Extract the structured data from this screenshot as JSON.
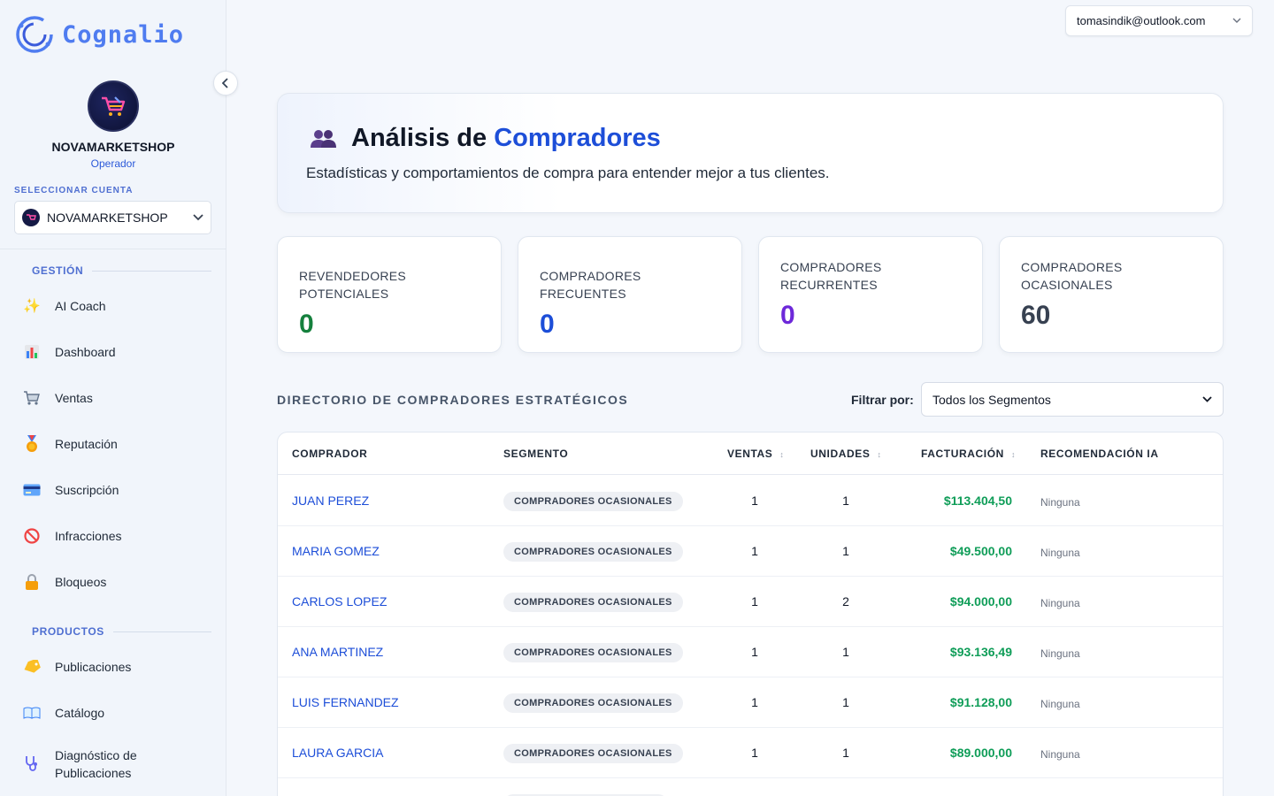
{
  "brand": {
    "name": "Cognalio"
  },
  "account": {
    "name": "NOVAMARKETSHOP",
    "role": "Operador",
    "select_label": "SELECCIONAR CUENTA",
    "selected": "NOVAMARKETSHOP"
  },
  "user": {
    "email": "tomasindik@outlook.com"
  },
  "sidebar": {
    "sections": [
      {
        "label": "GESTIÓN"
      },
      {
        "label": "PRODUCTOS"
      }
    ],
    "items": [
      {
        "label": "AI Coach",
        "icon": "sparkles-icon"
      },
      {
        "label": "Dashboard",
        "icon": "bar-chart-icon"
      },
      {
        "label": "Ventas",
        "icon": "shopping-cart-icon"
      },
      {
        "label": "Reputación",
        "icon": "medal-icon"
      },
      {
        "label": "Suscripción",
        "icon": "credit-card-icon"
      },
      {
        "label": "Infracciones",
        "icon": "prohibited-icon"
      },
      {
        "label": "Bloqueos",
        "icon": "lock-icon"
      },
      {
        "label": "Publicaciones",
        "icon": "tag-icon"
      },
      {
        "label": "Catálogo",
        "icon": "book-icon"
      },
      {
        "label": "Diagnóstico de Publicaciones",
        "label_line1": "Diagnóstico de",
        "label_line2": "Publicaciones",
        "icon": "stethoscope-icon"
      }
    ]
  },
  "header": {
    "title_part1": "Análisis de",
    "title_part2": "Compradores",
    "subtitle": "Estadísticas y comportamientos de compra para entender mejor a tus clientes."
  },
  "stats": [
    {
      "label": "REVENDEDORES POTENCIALES",
      "value": "0",
      "color": "#15803d"
    },
    {
      "label": "COMPRADORES FRECUENTES",
      "value": "0",
      "color": "#1d4ed8"
    },
    {
      "label_line1": "COMPRADORES",
      "label_line2": "RECURRENTES",
      "value": "0",
      "color": "#6d28d9"
    },
    {
      "label_line1": "COMPRADORES",
      "label_line2": "OCASIONALES",
      "value": "60",
      "color": "#374151"
    }
  ],
  "directory": {
    "title": "DIRECTORIO DE COMPRADORES ESTRATÉGICOS",
    "filter_label": "Filtrar por:",
    "filter_value": "Todos los Segmentos",
    "columns": [
      "COMPRADOR",
      "SEGMENTO",
      "VENTAS",
      "UNIDADES",
      "FACTURACIÓN",
      "RECOMENDACIÓN IA"
    ],
    "rows": [
      {
        "buyer": "JUAN PEREZ",
        "segment": "COMPRADORES OCASIONALES",
        "ventas": "1",
        "unidades": "1",
        "facturacion": "$113.404,50",
        "rec": "Ninguna"
      },
      {
        "buyer": "MARIA GOMEZ",
        "segment": "COMPRADORES OCASIONALES",
        "ventas": "1",
        "unidades": "1",
        "facturacion": "$49.500,00",
        "rec": "Ninguna"
      },
      {
        "buyer": "CARLOS LOPEZ",
        "segment": "COMPRADORES OCASIONALES",
        "ventas": "1",
        "unidades": "2",
        "facturacion": "$94.000,00",
        "rec": "Ninguna"
      },
      {
        "buyer": "ANA MARTINEZ",
        "segment": "COMPRADORES OCASIONALES",
        "ventas": "1",
        "unidades": "1",
        "facturacion": "$93.136,49",
        "rec": "Ninguna"
      },
      {
        "buyer": "LUIS FERNANDEZ",
        "segment": "COMPRADORES OCASIONALES",
        "ventas": "1",
        "unidades": "1",
        "facturacion": "$91.128,00",
        "rec": "Ninguna"
      },
      {
        "buyer": "LAURA GARCIA",
        "segment": "COMPRADORES OCASIONALES",
        "ventas": "1",
        "unidades": "1",
        "facturacion": "$89.000,00",
        "rec": "Ninguna"
      }
    ]
  }
}
